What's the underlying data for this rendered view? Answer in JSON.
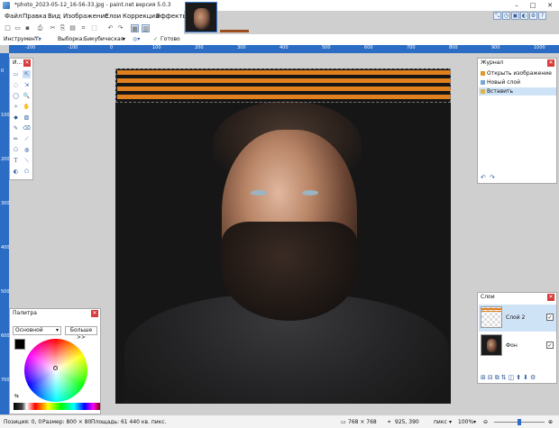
{
  "window": {
    "title": "*photo_2023-05-12_16-56-33.jpg - paint.net версия 5.0.3",
    "minimize": "–",
    "maximize": "□",
    "close": "✕"
  },
  "menu": {
    "items": [
      "Файл",
      "Правка",
      "Вид",
      "Изображение",
      "Слои",
      "Коррекция",
      "Эффекты"
    ]
  },
  "options_bar": {
    "tool_label": "Инструмент:",
    "selection_label": "Выборка:",
    "selection_value": "Бикубическая",
    "status_done": "Готово"
  },
  "rulers": {
    "h_ticks": [
      "-200",
      "-100",
      "0",
      "100",
      "200",
      "300",
      "400",
      "500",
      "600",
      "700",
      "800",
      "900",
      "1000"
    ],
    "v_ticks": [
      "0",
      "100",
      "200",
      "300",
      "400",
      "500",
      "600",
      "700"
    ]
  },
  "tools_panel": {
    "title": "И..."
  },
  "history_panel": {
    "title": "Журнал",
    "items": [
      "Открыть изображение",
      "Новый слой",
      "Вставить"
    ]
  },
  "layers_panel": {
    "title": "Слои",
    "layers": [
      {
        "name": "Слой 2",
        "visible": true,
        "selected": true
      },
      {
        "name": "Фон",
        "visible": true,
        "selected": false
      }
    ]
  },
  "palette_panel": {
    "title": "Палитра",
    "mode": "Основной",
    "more_button": "Больше >>",
    "primary_color": "#000000",
    "secondary_color": "#ffffff"
  },
  "status_bar": {
    "position": "Позиция: 0, 0",
    "size": "Размер: 800 × 80",
    "area": "Площадь: 61 440 кв. пикс.",
    "image_size": "768 × 768",
    "cursor": "925, 390",
    "units": "пикс",
    "zoom": "100%"
  },
  "colors": {
    "accent": "#2b6cc4",
    "stripe": "#e0801e"
  }
}
